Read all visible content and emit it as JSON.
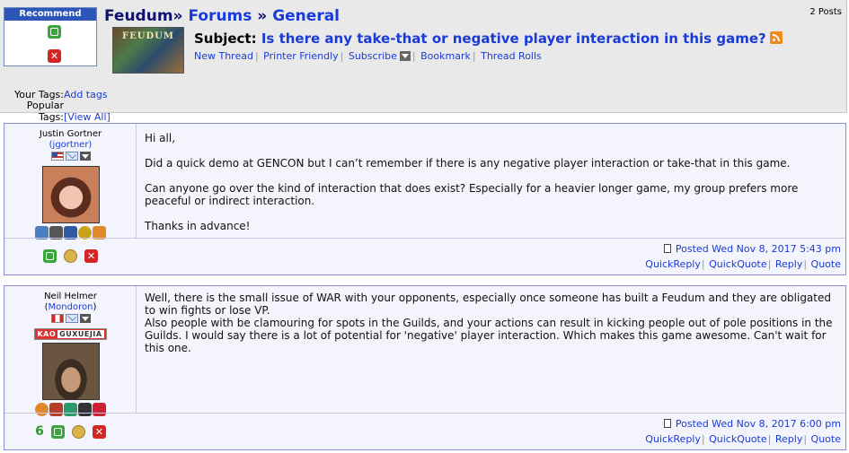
{
  "recommend": {
    "title": "Recommend"
  },
  "breadcrumb": {
    "site": "Feudum",
    "sep": "»",
    "forums": "Forums",
    "general": "General"
  },
  "posts_count": "2 Posts",
  "game": {
    "thumb_text": "FEUDUM"
  },
  "subject": {
    "label": "Subject:",
    "title": "Is there any take-that or negative player interaction in this game?"
  },
  "thread_links": [
    "New Thread",
    "Printer Friendly",
    "Subscribe",
    "Bookmark",
    "Thread Rolls"
  ],
  "tags": {
    "your_label": "Your Tags:",
    "your_link": "Add tags",
    "popular_label": "Popular Tags:",
    "popular_link": "[View All]"
  },
  "posts": [
    {
      "author": "Justin Gortner",
      "username": "(jgortner)",
      "body": [
        "Hi all,",
        "Did a quick demo at GENCON but I can’t remember if there is any negative player interaction or take-that in this game.",
        "Can anyone go over the kind of interaction that does exist? Especially for a heavier longer game, my group prefers more peaceful or indirect interaction.",
        "Thanks in advance!"
      ],
      "posted": "Posted Wed Nov 8, 2017 5:43 pm",
      "actions": [
        "QuickReply",
        "QuickQuote",
        "Reply",
        "Quote"
      ]
    },
    {
      "author": "Neil Helmer",
      "username_prefix": "(",
      "username": "Mondoron",
      "username_suffix": ")",
      "badge": "KAO",
      "badge_sub": "GUXUEJIA",
      "thumbs": "6",
      "body": [
        "Well, there is the small issue of WAR with your opponents, especially once someone has built a Feudum and they are obligated to win fights or lose VP.",
        "Also people with be clamouring for spots in the Guilds, and your actions can result in kicking people out of pole positions in the Guilds. I would say there is a lot of potential for 'negative' player interaction. Which makes this game awesome. Can't wait for this one."
      ],
      "posted": "Posted Wed Nov 8, 2017 6:00 pm",
      "actions": [
        "QuickReply",
        "QuickQuote",
        "Reply",
        "Quote"
      ]
    }
  ],
  "colors": {
    "link": "#1a3bd6",
    "post_border": "#8c8cd6",
    "post_bg": "#f4f4fc",
    "header_bg": "#e9e9e9",
    "thumb_green": "#3aa53a",
    "x_red": "#d42525"
  }
}
